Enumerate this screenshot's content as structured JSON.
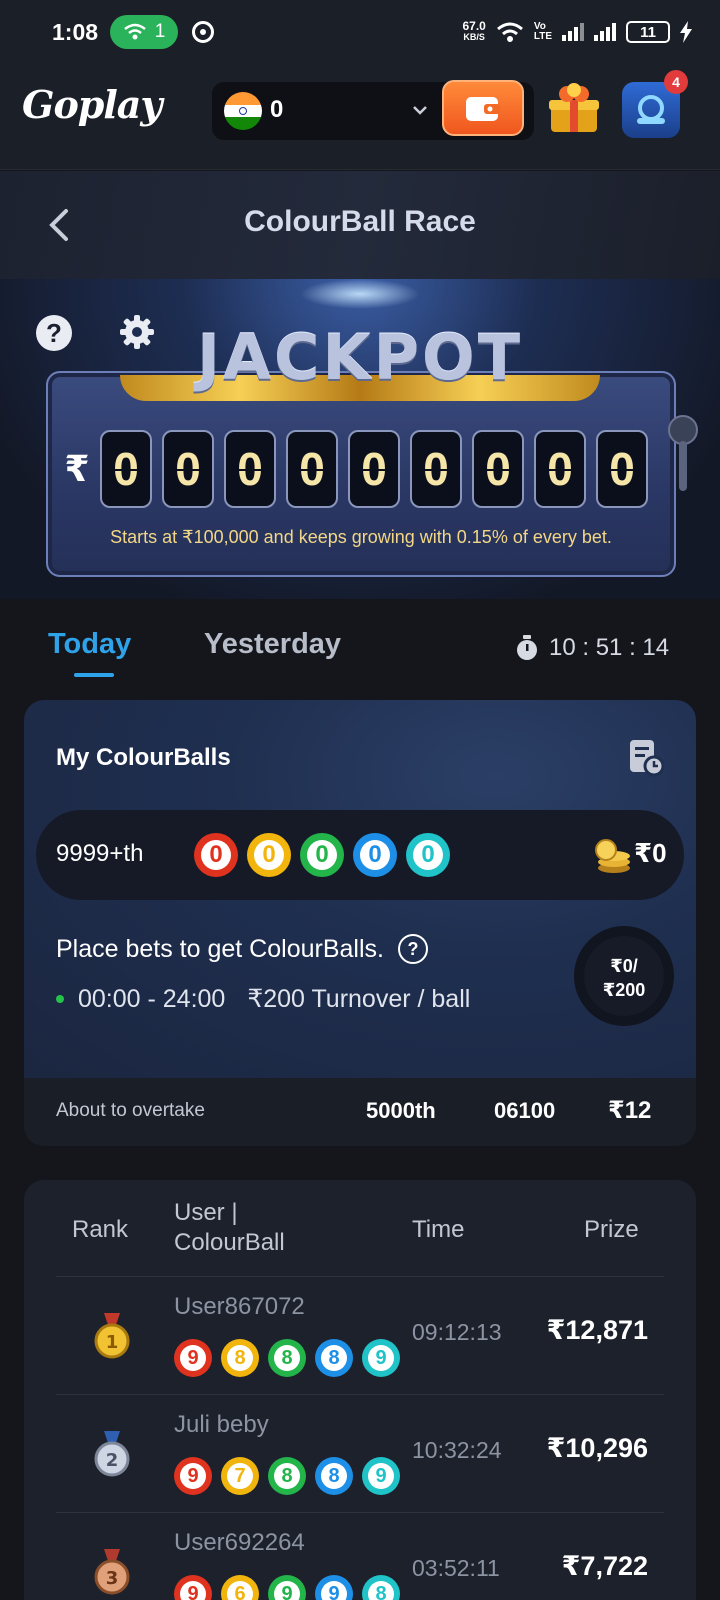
{
  "status_bar": {
    "time": "1:08",
    "hotspot_count": "1",
    "speed_value": "67.0",
    "speed_unit": "KB/S",
    "volte_top": "Vo",
    "volte_bottom": "LTE",
    "battery": "11"
  },
  "header": {
    "logo": "Goplay",
    "balance": "0",
    "notification_count": "4"
  },
  "page": {
    "title": "ColourBall Race"
  },
  "jackpot": {
    "word": "JACKPOT",
    "currency": "₹",
    "digits": [
      "0",
      "0",
      "0",
      "0",
      "0",
      "0",
      "0",
      "0",
      "0"
    ],
    "note": "Starts at ₹100,000 and keeps growing with 0.15% of every bet."
  },
  "tabs": {
    "today": "Today",
    "yesterday": "Yesterday",
    "timer": "10 : 51 : 14"
  },
  "my_colourballs": {
    "title": "My ColourBalls",
    "rank": "9999+th",
    "balls": [
      {
        "value": "0",
        "color": "#e0331f"
      },
      {
        "value": "0",
        "color": "#f2b50d"
      },
      {
        "value": "0",
        "color": "#23b44a"
      },
      {
        "value": "0",
        "color": "#1d8fe6"
      },
      {
        "value": "0",
        "color": "#1fc3c8"
      }
    ],
    "prize": "₹0",
    "place_bets_text": "Place bets to get ColourBalls.",
    "schedule": "00:00 - 24:00",
    "turnover": "₹200 Turnover / ball",
    "progress_current": "₹0/",
    "progress_target": "₹200",
    "progress_fraction": 0
  },
  "overtake": {
    "label": "About to overtake",
    "rank": "5000th",
    "balls": "06100",
    "prize": "₹12"
  },
  "ranking": {
    "headers": {
      "rank": "Rank",
      "user_line1": "User |",
      "user_line2": "ColourBall",
      "time": "Time",
      "prize": "Prize"
    },
    "rows": [
      {
        "medal": "1",
        "user": "User867072",
        "balls": [
          "9",
          "8",
          "8",
          "8",
          "9"
        ],
        "time": "09:12:13",
        "prize": "₹12,871"
      },
      {
        "medal": "2",
        "user": "Juli beby",
        "balls": [
          "9",
          "7",
          "8",
          "8",
          "9"
        ],
        "time": "10:32:24",
        "prize": "₹10,296"
      },
      {
        "medal": "3",
        "user": "User692264",
        "balls": [
          "9",
          "6",
          "9",
          "9",
          "8"
        ],
        "time": "03:52:11",
        "prize": "₹7,722"
      }
    ],
    "ball_colors": [
      "#e0331f",
      "#f2b50d",
      "#23b44a",
      "#1d8fe6",
      "#1fc3c8"
    ]
  },
  "colors": {
    "accent": "#2fa3ea",
    "wallet": "#f0571e"
  }
}
